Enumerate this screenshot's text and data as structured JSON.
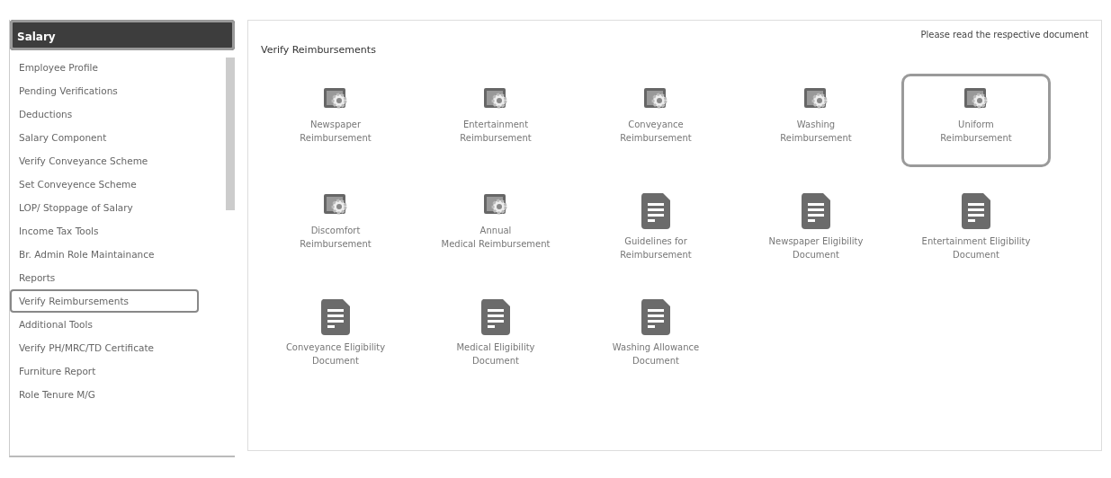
{
  "sidebar": {
    "header": {
      "label": "Salary",
      "highlighted": true
    },
    "items": [
      {
        "label": "Employee Profile",
        "selected": false
      },
      {
        "label": "Pending Verifications",
        "selected": false
      },
      {
        "label": "Deductions",
        "selected": false
      },
      {
        "label": "Salary Component",
        "selected": false
      },
      {
        "label": "Verify Conveyance Scheme",
        "selected": false
      },
      {
        "label": "Set Conveyence Scheme",
        "selected": false
      },
      {
        "label": "LOP/ Stoppage of Salary",
        "selected": false
      },
      {
        "label": "Income Tax Tools",
        "selected": false
      },
      {
        "label": "Br. Admin Role Maintainance",
        "selected": false
      },
      {
        "label": "Reports",
        "selected": false
      },
      {
        "label": "Verify Reimbursements",
        "selected": true
      },
      {
        "label": "Additional Tools",
        "selected": false
      },
      {
        "label": "Verify PH/MRC/TD Certificate",
        "selected": false
      },
      {
        "label": "Furniture Report",
        "selected": false
      },
      {
        "label": "Role Tenure M/G",
        "selected": false
      }
    ]
  },
  "main": {
    "title": "Verify Reimbursements",
    "note": "Please read the respective document",
    "tiles": [
      {
        "kind": "settings",
        "lines": [
          "Newspaper",
          "Reimbursement"
        ],
        "highlighted": false
      },
      {
        "kind": "settings",
        "lines": [
          "Entertainment",
          "Reimbursement"
        ],
        "highlighted": false
      },
      {
        "kind": "settings",
        "lines": [
          "Conveyance",
          "Reimbursement"
        ],
        "highlighted": false
      },
      {
        "kind": "settings",
        "lines": [
          "Washing",
          "Reimbursement"
        ],
        "highlighted": false
      },
      {
        "kind": "settings",
        "lines": [
          "Uniform",
          "Reimbursement"
        ],
        "highlighted": true
      },
      {
        "kind": "settings",
        "lines": [
          "Discomfort",
          "Reimbursement"
        ],
        "highlighted": false
      },
      {
        "kind": "settings",
        "lines": [
          "Annual",
          "Medical Reimbursement"
        ],
        "highlighted": false
      },
      {
        "kind": "document",
        "lines": [
          "Guidelines for",
          "Reimbursement"
        ],
        "highlighted": false
      },
      {
        "kind": "document",
        "lines": [
          "Newspaper Eligibility",
          "Document"
        ],
        "highlighted": false
      },
      {
        "kind": "document",
        "lines": [
          "Entertainment Eligibility",
          "Document"
        ],
        "highlighted": false
      },
      {
        "kind": "document",
        "lines": [
          "Conveyance Eligibility",
          "Document"
        ],
        "highlighted": false
      },
      {
        "kind": "document",
        "lines": [
          "Medical Eligibility",
          "Document"
        ],
        "highlighted": false
      },
      {
        "kind": "document",
        "lines": [
          "Washing Allowance",
          "Document"
        ],
        "highlighted": false
      }
    ]
  }
}
